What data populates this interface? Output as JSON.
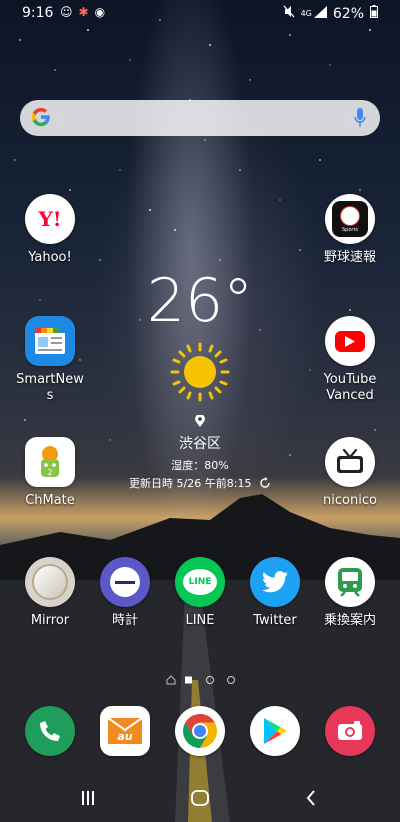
{
  "status": {
    "time": "9:16",
    "network": "4G",
    "battery": "62%",
    "left_icons": [
      "smile-notification-icon",
      "bug-notification-icon",
      "browser-notification-icon"
    ],
    "right_icons": [
      "mute-icon",
      "signal-icon",
      "battery-icon"
    ]
  },
  "search": {
    "placeholder": ""
  },
  "weather": {
    "temperature": "26°",
    "location": "渋谷区",
    "humidity": "湿度：80%",
    "updated": "更新日時 5/26 午前8:15"
  },
  "apps": {
    "yahoo": "Yahoo!",
    "yakyu": "野球速報",
    "smartnews": "SmartNews",
    "youtube_vanced": "YouTube Vanced",
    "chmate": "ChMate",
    "niconico": "niconico",
    "mirror": "Mirror",
    "clock": "時計",
    "line": "LINE",
    "twitter": "Twitter",
    "norikae": "乗換案内"
  },
  "icon_text": {
    "yahoo_logo": "Y!",
    "sports_badge": "Sports",
    "line_logo": "LINE",
    "au_logo": "au"
  },
  "dock": [
    "phone-icon",
    "au-mail-icon",
    "chrome-icon",
    "play-store-icon",
    "camera-icon"
  ],
  "pager": {
    "pages": 3,
    "current": 1
  },
  "colors": {
    "yahoo": "#ff0033",
    "youtube": "#ff0000",
    "line": "#06c755",
    "twitter": "#1da1f2",
    "norikae": "#2e9a4b",
    "clock": "#5c58c7",
    "phone": "#1e9e5a",
    "camera": "#e8385a"
  }
}
